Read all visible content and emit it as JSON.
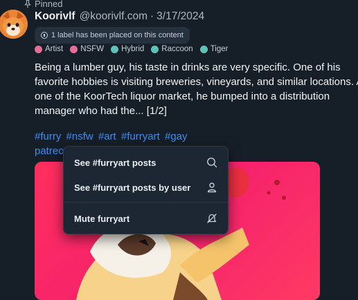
{
  "pinned_label": "Pinned",
  "post": {
    "display_name": "Koorivlf",
    "handle": "@koorivlf.com",
    "separator": "·",
    "date": "3/17/2024",
    "label_notice": "1 label has been placed on this content",
    "tags": [
      {
        "label": "Artist",
        "icon": "artist-icon",
        "color": "#e56f9a"
      },
      {
        "label": "NSFW",
        "icon": "nsfw-icon",
        "color": "#e56f9a"
      },
      {
        "label": "Hybrid",
        "icon": "globe-icon",
        "color": "#5cc3b5"
      },
      {
        "label": "Raccoon",
        "icon": "globe-icon",
        "color": "#5cc3b5"
      },
      {
        "label": "Tiger",
        "icon": "globe-icon",
        "color": "#5cc3b5"
      }
    ],
    "text_lines": [
      "Being a lumber guy, his taste in drinks are very specific. One of his",
      "favorite hobbies is visiting breweries, vineyards, and similar locations. At",
      "one of the KoorTech liquor market, he bumped into a distribution",
      "manager who had the... [1/2]"
    ],
    "hashtags_line1": [
      "#furry",
      "#nsfw",
      "#art",
      "#furryart",
      "#gay"
    ],
    "hashtags_line2": [
      "patreon"
    ]
  },
  "menu": {
    "items": [
      {
        "label": "See #furryart posts",
        "icon": "search-icon"
      },
      {
        "label": "See #furryart posts by user",
        "icon": "person-icon"
      },
      {
        "label": "Mute furryart",
        "icon": "mute-icon"
      }
    ]
  },
  "colors": {
    "background": "#161e27",
    "link": "#3d8df5",
    "image_background": "#ff2f5d"
  }
}
